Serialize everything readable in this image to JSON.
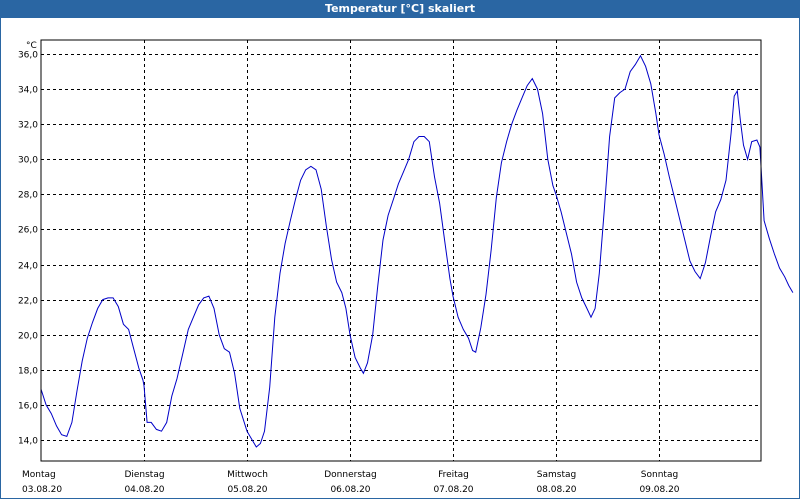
{
  "title": "Temperatur [°C] skaliert",
  "chart_data": {
    "type": "line",
    "unit": "°C",
    "ylim": [
      12.8,
      36.8
    ],
    "y_ticks": [
      "36,0",
      "34,0",
      "32,0",
      "30,0",
      "28,0",
      "26,0",
      "24,0",
      "22,0",
      "20,0",
      "18,0",
      "16,0",
      "14,0"
    ],
    "y_tick_values": [
      36,
      34,
      32,
      30,
      28,
      26,
      24,
      22,
      20,
      18,
      16,
      14
    ],
    "x_categories": [
      {
        "day": "Montag",
        "date": "03.08.20"
      },
      {
        "day": "Dienstag",
        "date": "04.08.20"
      },
      {
        "day": "Mittwoch",
        "date": "05.08.20"
      },
      {
        "day": "Donnerstag",
        "date": "06.08.20"
      },
      {
        "day": "Freitag",
        "date": "07.08.20"
      },
      {
        "day": "Samstag",
        "date": "08.08.20"
      },
      {
        "day": "Sonntag",
        "date": "09.08.20"
      }
    ],
    "grid": true,
    "series": [
      {
        "color": "#0000c8",
        "points": [
          [
            0.0,
            16.9
          ],
          [
            0.05,
            16.0
          ],
          [
            0.1,
            15.5
          ],
          [
            0.15,
            14.8
          ],
          [
            0.2,
            14.3
          ],
          [
            0.25,
            14.2
          ],
          [
            0.3,
            15.0
          ],
          [
            0.35,
            16.8
          ],
          [
            0.4,
            18.5
          ],
          [
            0.45,
            19.8
          ],
          [
            0.5,
            20.7
          ],
          [
            0.55,
            21.5
          ],
          [
            0.6,
            22.0
          ],
          [
            0.65,
            22.1
          ],
          [
            0.7,
            22.1
          ],
          [
            0.75,
            21.6
          ],
          [
            0.8,
            20.6
          ],
          [
            0.85,
            20.3
          ],
          [
            0.9,
            19.2
          ],
          [
            0.95,
            18.1
          ],
          [
            0.99,
            17.4
          ],
          [
            1.0,
            17.1
          ],
          [
            1.03,
            15.0
          ],
          [
            1.07,
            15.0
          ],
          [
            1.12,
            14.6
          ],
          [
            1.17,
            14.5
          ],
          [
            1.22,
            15.0
          ],
          [
            1.27,
            16.5
          ],
          [
            1.32,
            17.5
          ],
          [
            1.38,
            19.0
          ],
          [
            1.43,
            20.3
          ],
          [
            1.48,
            21.0
          ],
          [
            1.53,
            21.7
          ],
          [
            1.58,
            22.1
          ],
          [
            1.63,
            22.2
          ],
          [
            1.68,
            21.5
          ],
          [
            1.73,
            20.0
          ],
          [
            1.78,
            19.2
          ],
          [
            1.83,
            19.0
          ],
          [
            1.88,
            17.8
          ],
          [
            1.93,
            15.8
          ],
          [
            2.0,
            14.5
          ],
          [
            2.05,
            14.0
          ],
          [
            2.09,
            13.6
          ],
          [
            2.13,
            13.8
          ],
          [
            2.17,
            14.5
          ],
          [
            2.22,
            17.0
          ],
          [
            2.27,
            21.0
          ],
          [
            2.32,
            23.5
          ],
          [
            2.37,
            25.2
          ],
          [
            2.42,
            26.5
          ],
          [
            2.47,
            27.7
          ],
          [
            2.52,
            28.8
          ],
          [
            2.57,
            29.4
          ],
          [
            2.62,
            29.6
          ],
          [
            2.67,
            29.4
          ],
          [
            2.72,
            28.3
          ],
          [
            2.77,
            26.2
          ],
          [
            2.82,
            24.3
          ],
          [
            2.87,
            23.0
          ],
          [
            2.92,
            22.4
          ],
          [
            2.96,
            21.5
          ],
          [
            3.0,
            20.0
          ],
          [
            3.05,
            18.7
          ],
          [
            3.1,
            18.1
          ],
          [
            3.13,
            17.8
          ],
          [
            3.17,
            18.4
          ],
          [
            3.22,
            20.0
          ],
          [
            3.27,
            22.8
          ],
          [
            3.32,
            25.4
          ],
          [
            3.37,
            26.8
          ],
          [
            3.42,
            27.7
          ],
          [
            3.47,
            28.6
          ],
          [
            3.52,
            29.3
          ],
          [
            3.57,
            30.0
          ],
          [
            3.62,
            31.0
          ],
          [
            3.67,
            31.3
          ],
          [
            3.72,
            31.3
          ],
          [
            3.77,
            31.0
          ],
          [
            3.82,
            29.0
          ],
          [
            3.87,
            27.5
          ],
          [
            3.92,
            25.3
          ],
          [
            3.97,
            23.2
          ],
          [
            4.0,
            22.2
          ],
          [
            4.05,
            21.0
          ],
          [
            4.1,
            20.3
          ],
          [
            4.15,
            19.8
          ],
          [
            4.19,
            19.1
          ],
          [
            4.22,
            19.0
          ],
          [
            4.27,
            20.4
          ],
          [
            4.32,
            22.3
          ],
          [
            4.37,
            24.8
          ],
          [
            4.42,
            27.8
          ],
          [
            4.47,
            29.8
          ],
          [
            4.52,
            31.0
          ],
          [
            4.57,
            32.0
          ],
          [
            4.62,
            32.8
          ],
          [
            4.67,
            33.5
          ],
          [
            4.72,
            34.2
          ],
          [
            4.77,
            34.6
          ],
          [
            4.82,
            34.0
          ],
          [
            4.87,
            32.6
          ],
          [
            4.92,
            30.0
          ],
          [
            4.97,
            28.5
          ],
          [
            5.0,
            28.0
          ],
          [
            5.05,
            27.0
          ],
          [
            5.1,
            25.8
          ],
          [
            5.15,
            24.6
          ],
          [
            5.2,
            23.0
          ],
          [
            5.25,
            22.1
          ],
          [
            5.3,
            21.5
          ],
          [
            5.34,
            21.0
          ],
          [
            5.38,
            21.5
          ],
          [
            5.42,
            23.5
          ],
          [
            5.47,
            27.2
          ],
          [
            5.52,
            31.3
          ],
          [
            5.57,
            33.5
          ],
          [
            5.62,
            33.8
          ],
          [
            5.67,
            34.0
          ],
          [
            5.72,
            35.0
          ],
          [
            5.77,
            35.4
          ],
          [
            5.82,
            35.9
          ],
          [
            5.87,
            35.3
          ],
          [
            5.92,
            34.3
          ],
          [
            5.97,
            32.6
          ],
          [
            6.0,
            31.4
          ],
          [
            6.05,
            30.3
          ],
          [
            6.1,
            29.0
          ],
          [
            6.15,
            27.8
          ],
          [
            6.2,
            26.6
          ],
          [
            6.25,
            25.4
          ],
          [
            6.3,
            24.2
          ],
          [
            6.35,
            23.6
          ],
          [
            6.4,
            23.2
          ],
          [
            6.45,
            24.1
          ],
          [
            6.5,
            25.6
          ],
          [
            6.55,
            27.0
          ],
          [
            6.6,
            27.7
          ],
          [
            6.65,
            28.8
          ],
          [
            6.7,
            31.5
          ],
          [
            6.73,
            33.6
          ],
          [
            6.76,
            33.9
          ],
          [
            6.79,
            32.2
          ],
          [
            6.82,
            30.8
          ],
          [
            6.86,
            30.0
          ],
          [
            6.9,
            31.0
          ],
          [
            6.95,
            31.1
          ],
          [
            6.98,
            30.7
          ],
          [
            7.02,
            26.5
          ],
          [
            7.07,
            25.5
          ],
          [
            7.12,
            24.6
          ],
          [
            7.17,
            23.8
          ],
          [
            7.22,
            23.3
          ],
          [
            7.26,
            22.8
          ],
          [
            7.3,
            22.4
          ]
        ]
      }
    ]
  }
}
